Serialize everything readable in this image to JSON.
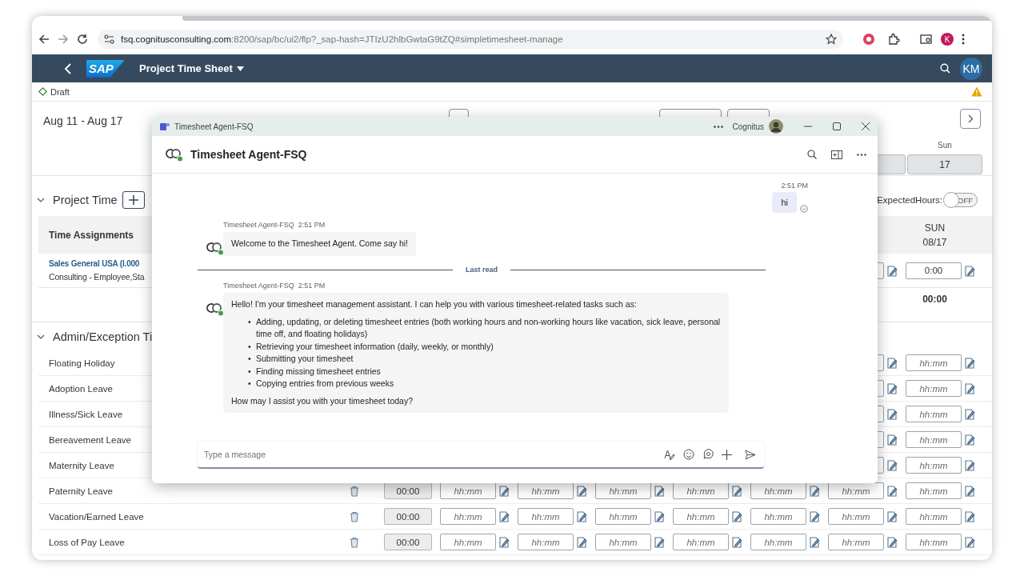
{
  "browser": {
    "url_host": "fsq.cognitusconsulting.com",
    "url_path": ":8200/sap/bc/ui2/flp?_sap-hash=JTIzU2hlbGwtaG9tZQ#simpletimesheet-manage",
    "profile_initial": "K"
  },
  "shell": {
    "logo": "SAP",
    "title": "Project Time Sheet",
    "user_initials": "KM"
  },
  "status": {
    "label": "Draft"
  },
  "week": {
    "range": "Aug 11 - Aug 17",
    "day_name": "Sun",
    "day_number": "17"
  },
  "project_time": {
    "title": "Project Time",
    "expected_hours_label": "ExpectedHours:",
    "expected_hours_on": false,
    "toggle_text": "OFF",
    "column_header": "Time Assignments",
    "day_columns": [
      {
        "name": "SUN",
        "date": "08/17"
      }
    ],
    "assignments": [
      {
        "name": "Sales General USA (I.000",
        "detail": "Consulting - Employee,Sta",
        "entries": [
          {
            "value": "0:00"
          }
        ]
      }
    ],
    "totals": [
      "00:00"
    ]
  },
  "admin": {
    "title": "Admin/Exception Ti",
    "rows": [
      {
        "name": "Floating Holiday",
        "entries": [
          {
            "placeholder": "hh:mm"
          }
        ]
      },
      {
        "name": "Adoption Leave",
        "entries": [
          {
            "placeholder": "hh:mm"
          }
        ]
      },
      {
        "name": "Illness/Sick Leave",
        "entries": [
          {
            "placeholder": "hh:mm"
          }
        ]
      },
      {
        "name": "Bereavement Leave",
        "entries": [
          {
            "placeholder": "hh:mm"
          }
        ]
      },
      {
        "name": "Maternity Leave",
        "entries": [
          {
            "placeholder": "hh:mm"
          }
        ]
      },
      {
        "name": "Paternity Leave",
        "total": "00:00",
        "entries": [
          {
            "placeholder": "hh:mm"
          },
          {
            "placeholder": "hh:mm"
          },
          {
            "placeholder": "hh:mm"
          },
          {
            "placeholder": "hh:mm"
          },
          {
            "placeholder": "hh:mm"
          },
          {
            "placeholder": "hh:mm"
          },
          {
            "placeholder": "hh:mm"
          }
        ]
      },
      {
        "name": "Vacation/Earned Leave",
        "total": "00:00",
        "entries": [
          {
            "placeholder": "hh:mm"
          },
          {
            "placeholder": "hh:mm"
          },
          {
            "placeholder": "hh:mm"
          },
          {
            "placeholder": "hh:mm"
          },
          {
            "placeholder": "hh:mm"
          },
          {
            "placeholder": "hh:mm"
          },
          {
            "placeholder": "hh:mm"
          }
        ]
      },
      {
        "name": "Loss of Pay Leave",
        "total": "00:00",
        "entries": [
          {
            "placeholder": "hh:mm"
          },
          {
            "placeholder": "hh:mm"
          },
          {
            "placeholder": "hh:mm"
          },
          {
            "placeholder": "hh:mm"
          },
          {
            "placeholder": "hh:mm"
          },
          {
            "placeholder": "hh:mm"
          },
          {
            "placeholder": "hh:mm"
          }
        ]
      }
    ]
  },
  "chat": {
    "window_title": "Timesheet Agent-FSQ",
    "account": "Cognitus",
    "bot_name": "Timesheet Agent-FSQ",
    "messages": [
      {
        "kind": "outgoing",
        "time": "2:51 PM",
        "text": "hi"
      },
      {
        "kind": "incoming",
        "sender": "Timesheet Agent-FSQ",
        "time": "2:51 PM",
        "intro": "Welcome to the Timesheet Agent. Come say hi!"
      },
      {
        "kind": "divider",
        "text": "Last read"
      },
      {
        "kind": "incoming",
        "sender": "Timesheet Agent-FSQ",
        "time": "2:51 PM",
        "bullet_marker": "•",
        "intro": "Hello! I'm your timesheet management assistant. I can help you with various timesheet-related tasks such as:",
        "bullets": [
          "Adding, updating, or deleting timesheet entries (both working hours and non-working hours like vacation, sick leave, personal time off, and floating holidays)",
          "Retrieving your timesheet information (daily, weekly, or monthly)",
          "Submitting your timesheet",
          "Finding missing timesheet entries",
          "Copying entries from previous weeks"
        ],
        "outro": "How may I assist you with your timesheet today?"
      }
    ],
    "compose": {
      "placeholder": "Type a message"
    }
  }
}
